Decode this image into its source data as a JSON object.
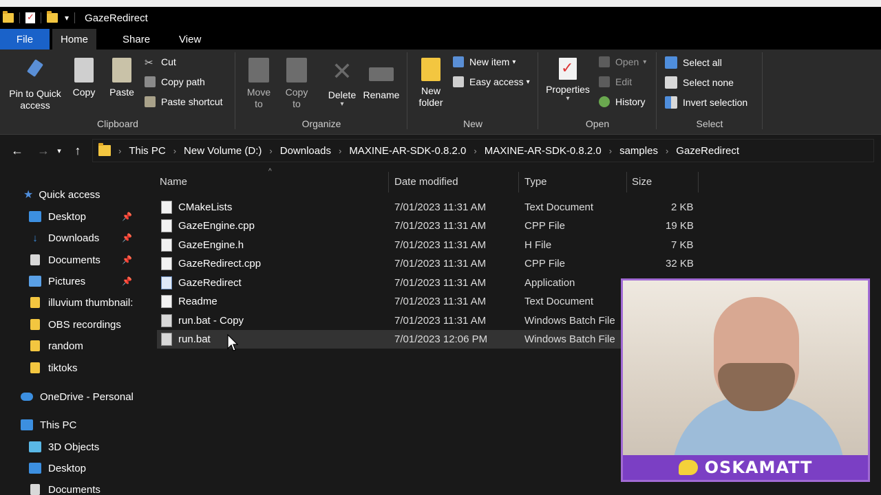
{
  "window": {
    "title": "GazeRedirect"
  },
  "tabs": [
    "File",
    "Home",
    "Share",
    "View"
  ],
  "ribbon": {
    "clipboard": {
      "label": "Clipboard",
      "pin": "Pin to Quick access",
      "copy": "Copy",
      "paste": "Paste",
      "cut": "Cut",
      "copy_path": "Copy path",
      "paste_shortcut": "Paste shortcut"
    },
    "organize": {
      "label": "Organize",
      "move_to": "Move to",
      "copy_to": "Copy to",
      "delete": "Delete",
      "rename": "Rename"
    },
    "new": {
      "label": "New",
      "new_folder": "New folder",
      "new_item": "New item",
      "easy_access": "Easy access"
    },
    "open": {
      "label": "Open",
      "properties": "Properties",
      "open": "Open",
      "edit": "Edit",
      "history": "History"
    },
    "select": {
      "label": "Select",
      "select_all": "Select all",
      "select_none": "Select none",
      "invert": "Invert selection"
    }
  },
  "breadcrumbs": [
    "This PC",
    "New Volume (D:)",
    "Downloads",
    "MAXINE-AR-SDK-0.8.2.0",
    "MAXINE-AR-SDK-0.8.2.0",
    "samples",
    "GazeRedirect"
  ],
  "sidebar": {
    "quick_access": "Quick access",
    "items": [
      "Desktop",
      "Downloads",
      "Documents",
      "Pictures",
      "illuvium thumbnail:",
      "OBS recordings",
      "random",
      "tiktoks"
    ],
    "onedrive": "OneDrive - Personal",
    "this_pc": "This PC",
    "pc_items": [
      "3D Objects",
      "Desktop",
      "Documents"
    ]
  },
  "columns": {
    "name": "Name",
    "date": "Date modified",
    "type": "Type",
    "size": "Size"
  },
  "files": [
    {
      "name": "CMakeLists",
      "date": "7/01/2023 11:31 AM",
      "type": "Text Document",
      "size": "2 KB"
    },
    {
      "name": "GazeEngine.cpp",
      "date": "7/01/2023 11:31 AM",
      "type": "CPP File",
      "size": "19 KB"
    },
    {
      "name": "GazeEngine.h",
      "date": "7/01/2023 11:31 AM",
      "type": "H File",
      "size": "7 KB"
    },
    {
      "name": "GazeRedirect.cpp",
      "date": "7/01/2023 11:31 AM",
      "type": "CPP File",
      "size": "32 KB"
    },
    {
      "name": "GazeRedirect",
      "date": "7/01/2023 11:31 AM",
      "type": "Application",
      "size": ""
    },
    {
      "name": "Readme",
      "date": "7/01/2023 11:31 AM",
      "type": "Text Document",
      "size": ""
    },
    {
      "name": "run.bat - Copy",
      "date": "7/01/2023 11:31 AM",
      "type": "Windows Batch File",
      "size": ""
    },
    {
      "name": "run.bat",
      "date": "7/01/2023 12:06 PM",
      "type": "Windows Batch File",
      "size": ""
    }
  ],
  "webcam": {
    "handle": "OSKAMATT"
  }
}
